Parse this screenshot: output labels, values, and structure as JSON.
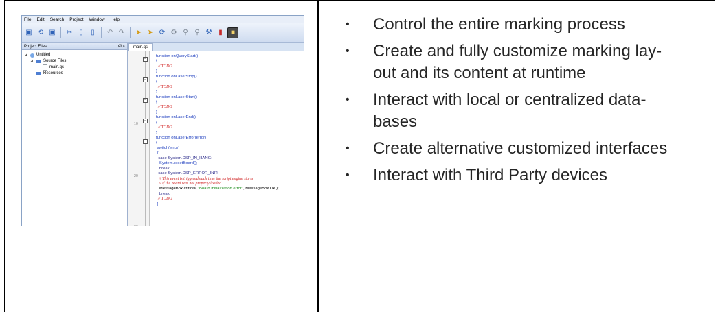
{
  "menu": [
    "File",
    "Edit",
    "Search",
    "Project",
    "Window",
    "Help"
  ],
  "toolbar_icons": [
    "new-file-icon",
    "open-folder-icon",
    "save-icon",
    "separator",
    "cut-icon",
    "copy-icon",
    "paste-icon",
    "separator",
    "undo-icon",
    "redo-icon",
    "separator",
    "run-icon",
    "step-icon",
    "refresh-icon",
    "settings-icon",
    "search-icon",
    "search-next-icon",
    "tools-icon",
    "chart-icon",
    "app-icon"
  ],
  "project_panel": {
    "title": "Project Files",
    "float_label": "Ø",
    "close_label": "×",
    "tree": {
      "root": "Untitled",
      "source_files": "Source Files",
      "file": "main.qs",
      "resources": "Resources"
    }
  },
  "editor": {
    "tab": "main.qs",
    "line_numbers": [
      "10",
      "20",
      "30"
    ],
    "lines": [
      "function onQueryStart()",
      "{",
      "  // TODO",
      "}",
      "function onLaserStop()",
      "{",
      "  // TODO",
      "}",
      "function onLaserStart()",
      "{",
      "  // TODO",
      "}",
      "function onLaserEnd()",
      "{",
      "  // TODO",
      "}",
      "function onLaserError(error)",
      "{",
      " switch(error)",
      " {",
      "  case System.DSP_IN_HANG:",
      "   System.resetBoard();",
      "   break;",
      "  case System.DSP_ERROR_INIT:",
      "   // This event is triggered each time the script engine starts",
      "   // if the board was not properly loaded",
      "   MessageBox.critical( \"Board initialization error\", MessageBox.Ok );",
      "   break;",
      "  // TODO",
      " }"
    ]
  },
  "bullets": [
    "Control the entire marking process",
    "Create and fully customize marking lay-\nout and its content at runtime",
    "Interact with local or centralized data-\nbases",
    "Create alternative customized interfaces",
    "Interact with Third Party devices"
  ],
  "bullet_symbol": "•"
}
